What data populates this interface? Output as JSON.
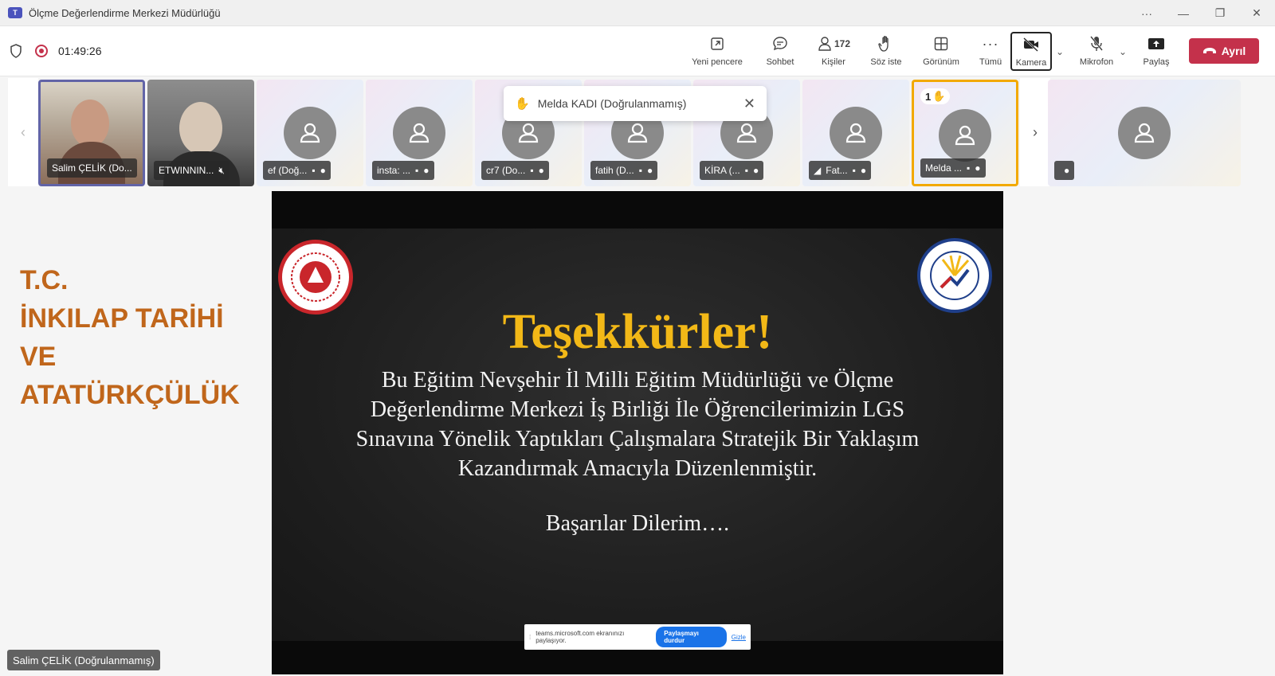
{
  "window": {
    "title": "Ölçme Değerlendirme Merkezi Müdürlüğü",
    "controls": [
      "···",
      "—",
      "❐",
      "✕"
    ]
  },
  "meeting": {
    "timer": "01:49:26"
  },
  "toolbar": {
    "new_window": "Yeni pencere",
    "chat": "Sohbet",
    "people_count": "172",
    "people": "Kişiler",
    "raise_hand": "Söz iste",
    "view": "Görünüm",
    "more": "Tümü",
    "camera": "Kamera",
    "mic": "Mikrofon",
    "share": "Paylaş",
    "leave": "Ayrıl"
  },
  "participants": [
    {
      "name": "Salim ÇELİK (Do..."
    },
    {
      "name": "ETWINNIN..."
    },
    {
      "name": "ef (Doğ..."
    },
    {
      "name": "insta: ..."
    },
    {
      "name": "cr7 (Do..."
    },
    {
      "name": "fatih (D..."
    },
    {
      "name": "KİRA (..."
    },
    {
      "name": "Fat..."
    },
    {
      "name": "Melda ...",
      "hand_count": "1"
    },
    {
      "name": ""
    }
  ],
  "toast": {
    "text": "Melda KADI (Doğrulanmamış)"
  },
  "side_text": {
    "line1": "T.C.",
    "line2": "İNKILAP TARİHİ",
    "line3": "VE",
    "line4": "ATATÜRKÇÜLÜK"
  },
  "slide": {
    "title": "Teşekkürler!",
    "body_line1": "Bu Eğitim Nevşehir İl Milli Eğitim Müdürlüğü ve Ölçme",
    "body_line2": "Değerlendirme Merkezi İş Birliği İle Öğrencilerimizin LGS",
    "body_line3": "Sınavına Yönelik Yaptıkları Çalışmalara Stratejik Bir Yaklaşım",
    "body_line4": "Kazandırmak Amacıyla Düzenlenmiştir.",
    "regards": "Başarılar Dilerim…."
  },
  "share_bar": {
    "text": "teams.microsoft.com ekranınızı paylaşıyor.",
    "stop": "Paylaşmayı durdur",
    "hide": "Gizle"
  },
  "speaker_label": "Salim ÇELİK (Doğrulanmamış)",
  "colors": {
    "accent_active": "#6264a7",
    "raised_hand": "#f2a900",
    "leave": "#c4314b",
    "side_text": "#c0661b",
    "slide_title": "#f2b817"
  }
}
